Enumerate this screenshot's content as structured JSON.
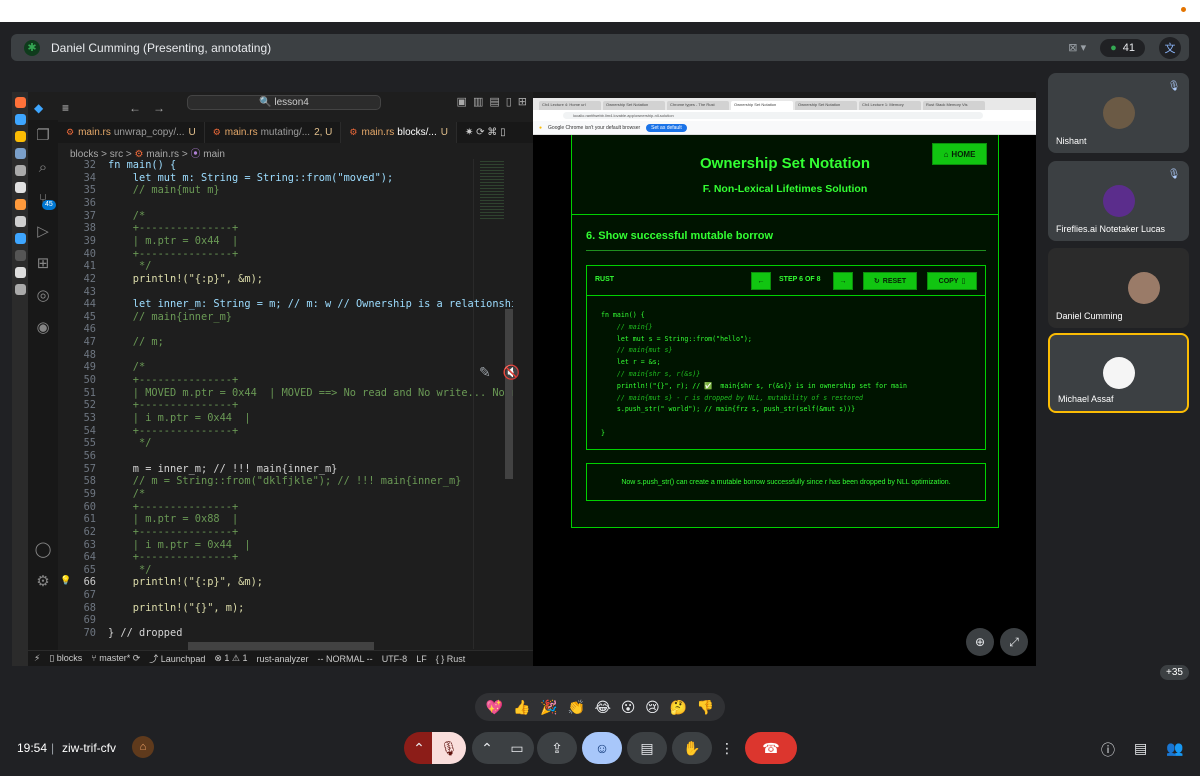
{
  "presenter": {
    "name": "Daniel Cumming (Presenting, annotating)",
    "participant_count": "41"
  },
  "vscode": {
    "search": "lesson4",
    "tabs": [
      {
        "name": "main.rs",
        "path": "unwrap_copy/...",
        "state": "U"
      },
      {
        "name": "main.rs",
        "path": "mutating/...",
        "state": "2, U"
      },
      {
        "name": "main.rs",
        "path": "blocks/...",
        "state": "U"
      }
    ],
    "breadcrumb": [
      "blocks",
      "src",
      "main.rs",
      "main"
    ],
    "status": {
      "branch_folder": "blocks",
      "branch": "master*",
      "launchpad": "Launchpad",
      "errors": "1",
      "warnings": "1",
      "lsp": "rust-analyzer",
      "mode": "-- NORMAL --",
      "encoding": "UTF-8",
      "eol": "LF",
      "lang": "Rust"
    },
    "lines": [
      {
        "n": "32",
        "t": "fn main() {"
      },
      {
        "n": "34",
        "t": "    let mut m: String = String::from(\"moved\");"
      },
      {
        "n": "35",
        "t": "    // main{mut m}"
      },
      {
        "n": "36",
        "t": ""
      },
      {
        "n": "37",
        "t": "    /*"
      },
      {
        "n": "38",
        "t": "    +---------------+"
      },
      {
        "n": "39",
        "t": "    | m.ptr = 0x44  |"
      },
      {
        "n": "40",
        "t": "    +---------------+"
      },
      {
        "n": "41",
        "t": "     */"
      },
      {
        "n": "42",
        "t": "    println!(\"{:p}\", &m);"
      },
      {
        "n": "43",
        "t": ""
      },
      {
        "n": "44",
        "t": "    let inner_m: String = m; // m: w // Ownership is a relationship"
      },
      {
        "n": "45",
        "t": "    // main{inner_m}"
      },
      {
        "n": "46",
        "t": ""
      },
      {
        "n": "47",
        "t": "    // m;"
      },
      {
        "n": "48",
        "t": ""
      },
      {
        "n": "49",
        "t": "    /*"
      },
      {
        "n": "50",
        "t": "    +---------------+"
      },
      {
        "n": "51",
        "t": "    | MOVED m.ptr = 0x44  | MOVED ==> No read and No write... No re"
      },
      {
        "n": "52",
        "t": "    +---------------+"
      },
      {
        "n": "53",
        "t": "    | i m.ptr = 0x44  |"
      },
      {
        "n": "54",
        "t": "    +---------------+"
      },
      {
        "n": "55",
        "t": "     */"
      },
      {
        "n": "56",
        "t": ""
      },
      {
        "n": "57",
        "t": "    m = inner_m; // !!! main{inner_m}"
      },
      {
        "n": "58",
        "t": "    // m = String::from(\"dklfjkle\"); // !!! main{inner_m}"
      },
      {
        "n": "59",
        "t": "    /*"
      },
      {
        "n": "60",
        "t": "    +---------------+"
      },
      {
        "n": "61",
        "t": "    | m.ptr = 0x88  |"
      },
      {
        "n": "62",
        "t": "    +---------------+"
      },
      {
        "n": "63",
        "t": "    | i m.ptr = 0x44  |"
      },
      {
        "n": "64",
        "t": "    +---------------+"
      },
      {
        "n": "65",
        "t": "     */"
      },
      {
        "n": "66",
        "t": "    println!(\"{:p}\", &m);"
      },
      {
        "n": "67",
        "t": ""
      },
      {
        "n": "68",
        "t": "    println!(\"{}\", m);"
      },
      {
        "n": "69",
        "t": ""
      },
      {
        "n": "70",
        "t": "} // dropped"
      }
    ],
    "current_line": "66"
  },
  "browser": {
    "tabs": [
      "Ch4 Lecture 4: Home url",
      "Ownership Set Notation",
      "Chrome types - The Rust",
      "Ownership Set Notation",
      "Ownership Set Notation",
      "Ch4 Lecture 1: Memory",
      "Rust Stack Memory Vis"
    ],
    "url": "localio.rantfiwebb.lim4.lovable.app/ownership-nll-solution",
    "default_msg": "Google Chrome isn't your default browser",
    "set_default": "Set as default"
  },
  "lesson": {
    "title": "Ownership Set Notation",
    "subtitle": "F. Non-Lexical Lifetimes Solution",
    "home": "HOME",
    "section": "6. Show successful mutable borrow",
    "lang": "RUST",
    "prev": "←",
    "next": "→",
    "step": "STEP 6 OF 8",
    "reset": "RESET",
    "copy": "COPY",
    "code": [
      "fn main() {",
      "    // main{}",
      "    let mut s = String::from(\"hello\");",
      "    // main{mut s}",
      "    let r = &s;",
      "    // main{shr s, r(&s)}",
      "    println!(\"{}\", r); // ✅  main{shr s, r(&s)} is in ownership set for main",
      "    // main{mut s} - r is dropped by NLL, mutability of s restored",
      "    s.push_str(\" world\"); // main{frz s, push_str(self(&mut s))}",
      "",
      "}"
    ],
    "note": "Now s.push_str() can create a mutable borrow successfully since r has been dropped by NLL optimization."
  },
  "participants": [
    {
      "name": "Nishant"
    },
    {
      "name": "Fireflies.ai Notetaker Lucas"
    },
    {
      "name": "Daniel Cumming"
    },
    {
      "name": "Michael Assaf"
    }
  ],
  "more_count": "+35",
  "reactions": [
    "💖",
    "👍",
    "🎉",
    "👏",
    "😂",
    "😮",
    "😢",
    "🤔",
    "👎"
  ],
  "bottom": {
    "time": "19:54",
    "separator": "|",
    "meeting_code": "ziw-trif-cfv"
  }
}
